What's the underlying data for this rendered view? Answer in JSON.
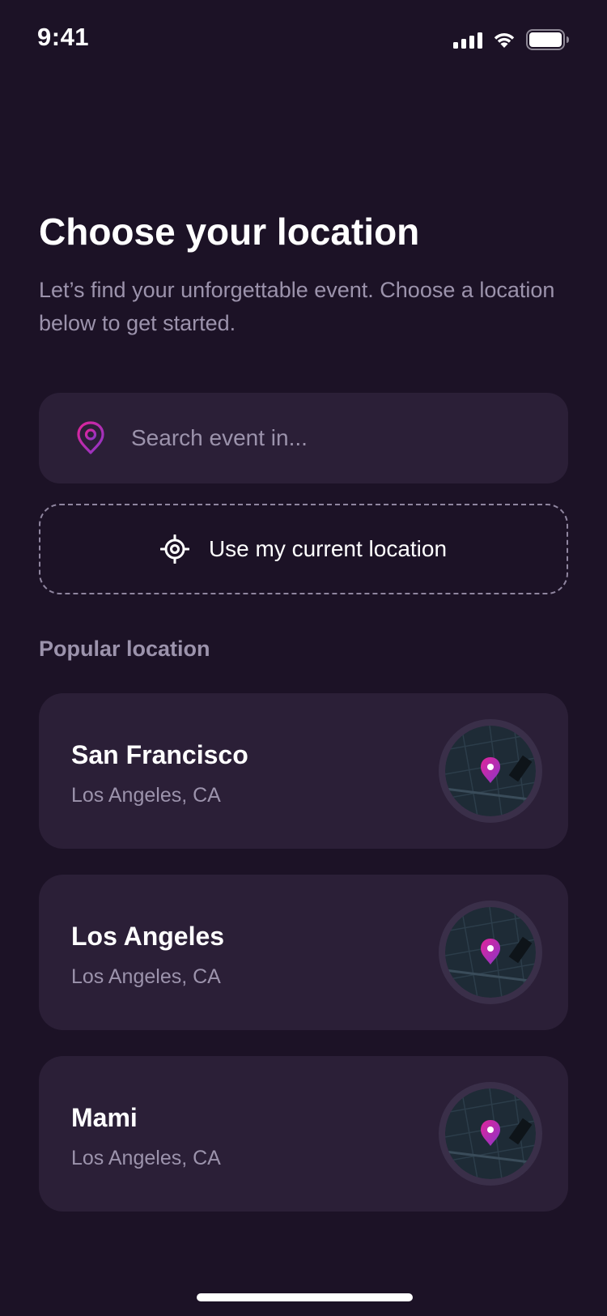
{
  "status_bar": {
    "time": "9:41"
  },
  "header": {
    "title": "Choose your location",
    "subtitle": "Let’s find your unforgettable event. Choose a location below to get started."
  },
  "search": {
    "placeholder": "Search event in...",
    "value": "",
    "icon": "map-pin-icon"
  },
  "current_location": {
    "label": "Use my current location",
    "icon": "target-icon"
  },
  "popular": {
    "title": "Popular location",
    "items": [
      {
        "name": "San Francisco",
        "subtitle": "Los Angeles, CA"
      },
      {
        "name": "Los Angeles",
        "subtitle": "Los Angeles, CA"
      },
      {
        "name": "Mami",
        "subtitle": "Los Angeles, CA"
      }
    ]
  },
  "colors": {
    "background": "#1c1226",
    "card": "#2b1f37",
    "muted_text": "#9c93ac",
    "accent_gradient_start": "#e0249a",
    "accent_gradient_end": "#8a36c8"
  }
}
